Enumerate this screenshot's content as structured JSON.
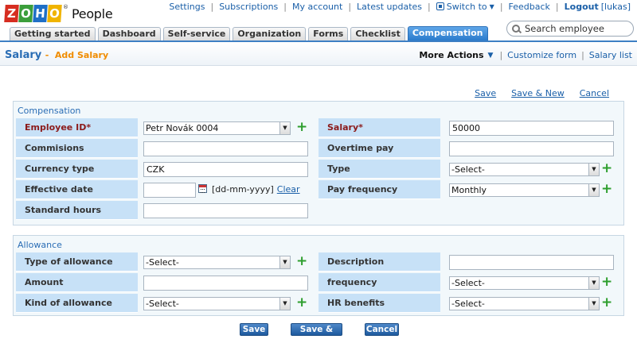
{
  "logo": {
    "letters": [
      "Z",
      "O",
      "H",
      "O"
    ],
    "reg": "®",
    "product": "People"
  },
  "toplinks": {
    "settings": "Settings",
    "subscriptions": "Subscriptions",
    "my_account": "My account",
    "latest_updates": "Latest updates",
    "switch_to": "Switch to",
    "feedback": "Feedback",
    "logout": "Logout",
    "user": "[lukas]"
  },
  "tabs": [
    "Getting started",
    "Dashboard",
    "Self-service",
    "Organization",
    "Forms",
    "Checklist",
    "Compensation"
  ],
  "active_tab": "Compensation",
  "search": {
    "placeholder": "Search employee"
  },
  "subheader": {
    "title": "Salary",
    "separator": "-",
    "subtitle": "Add Salary",
    "more_actions": "More Actions",
    "customize_form": "Customize form",
    "salary_list": "Salary list"
  },
  "form_links": {
    "save": "Save",
    "save_new": "Save & New",
    "cancel": "Cancel"
  },
  "compensation": {
    "title": "Compensation",
    "employee_id_label": "Employee ID*",
    "employee_id_value": "Petr Novák 0004",
    "salary_label": "Salary*",
    "salary_value": "50000",
    "commisions_label": "Commisions",
    "commisions_value": "",
    "overtime_label": "Overtime pay",
    "overtime_value": "",
    "currency_label": "Currency type",
    "currency_value": "CZK",
    "type_label": "Type",
    "type_value": "-Select-",
    "effective_label": "Effective date",
    "effective_value": "",
    "date_format": "[dd-mm-yyyy]",
    "clear": "Clear",
    "pay_freq_label": "Pay frequency",
    "pay_freq_value": "Monthly",
    "std_hours_label": "Standard hours",
    "std_hours_value": ""
  },
  "allowance": {
    "title": "Allowance",
    "type_label": "Type of allowance",
    "type_value": "-Select-",
    "description_label": "Description",
    "description_value": "",
    "amount_label": "Amount",
    "amount_value": "",
    "frequency_label": "frequency",
    "frequency_value": "-Select-",
    "kind_label": "Kind of allowance",
    "kind_value": "-Select-",
    "hr_label": "HR benefits",
    "hr_value": "-Select-"
  },
  "buttons": {
    "save": "Save",
    "save_new": "Save & New",
    "cancel": "Cancel"
  },
  "colors": {
    "accent": "#2a7bcc",
    "label_bg": "#c7e1f7",
    "required": "#8b1a1a",
    "add_green": "#2e9e2e",
    "subtitle_orange": "#f08c00"
  }
}
